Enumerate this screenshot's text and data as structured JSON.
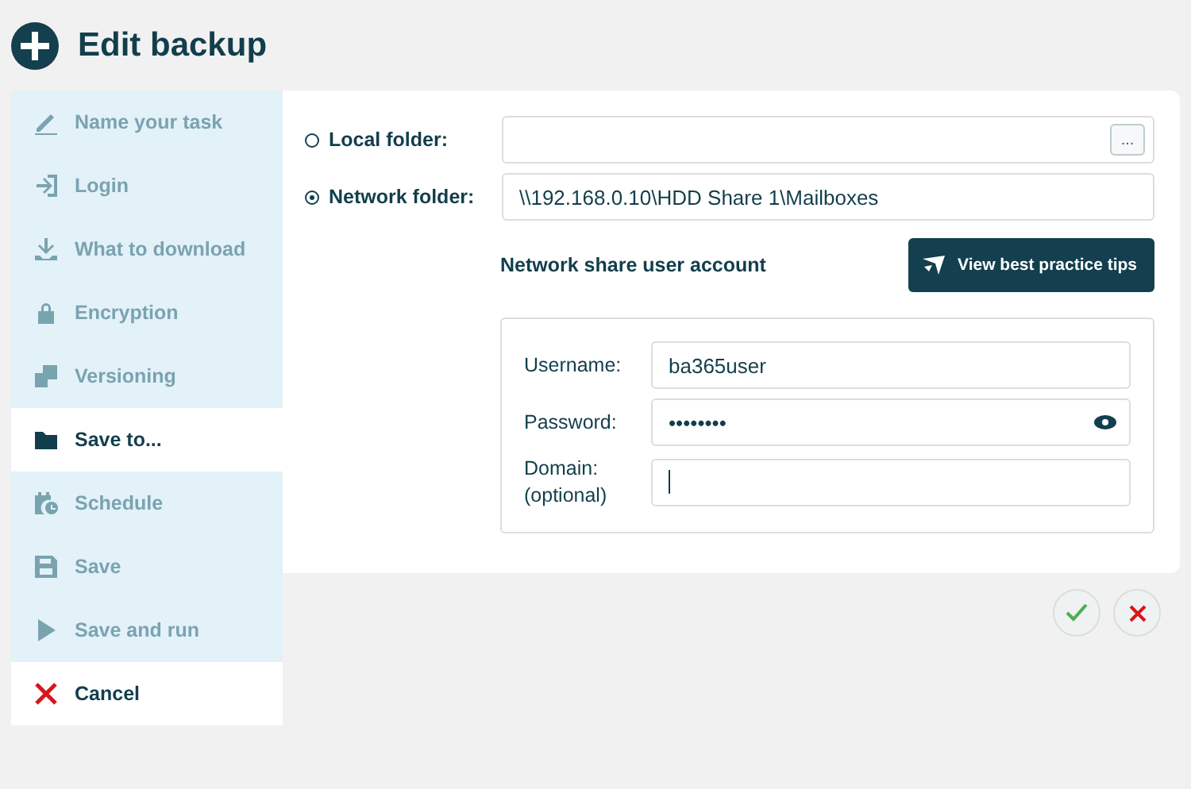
{
  "header": {
    "title": "Edit backup"
  },
  "sidebar": {
    "items": [
      {
        "label": "Name your task",
        "kind": "step",
        "selected": false
      },
      {
        "label": "Login",
        "kind": "step",
        "selected": false
      },
      {
        "label": "What to download",
        "kind": "step",
        "selected": false
      },
      {
        "label": "Encryption",
        "kind": "step",
        "selected": false
      },
      {
        "label": "Versioning",
        "kind": "step",
        "selected": false
      },
      {
        "label": "Save to...",
        "kind": "step",
        "selected": true
      },
      {
        "label": "Schedule",
        "kind": "step",
        "selected": false
      },
      {
        "label": "Save",
        "kind": "step",
        "selected": false
      },
      {
        "label": "Save and run",
        "kind": "step",
        "selected": false
      },
      {
        "label": "Cancel",
        "kind": "cancel"
      }
    ]
  },
  "destinations": [
    {
      "label": "Local folder:",
      "selected": false,
      "browse": "..."
    },
    {
      "label": "Network folder:",
      "selected": true,
      "value": "\\\\192.168.0.10\\HDD Share 1\\Mailboxes"
    }
  ],
  "account": {
    "title": "Network share user account",
    "tips_button": "View best practice tips",
    "fields": [
      {
        "label": "Username:",
        "value": "ba365user",
        "kind": "text",
        "focused": false
      },
      {
        "label": "Password:",
        "value": "••••••••",
        "kind": "password",
        "focused": false
      },
      {
        "label": "Domain:\n(optional)",
        "kind": "text",
        "focused": true
      }
    ]
  }
}
